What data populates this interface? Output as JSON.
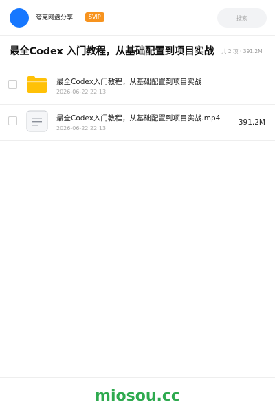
{
  "header": {
    "brand": "夸克网盘分享",
    "badge": "SVIP",
    "search_placeholder": "搜索"
  },
  "folder": {
    "title": "最全Codex 入门教程，从基础配置到项目实战",
    "meta": "共 2 项 · 391.2M"
  },
  "files": [
    {
      "icon": "folder-icon",
      "name": "最全Codex入门教程，从基础配置到项目实战",
      "date": "2026-06-22 22:13",
      "size": ""
    },
    {
      "icon": "document-icon",
      "name": "最全Codex入门教程，从基础配置到项目实战.mp4",
      "date": "2026-06-22 22:13",
      "size": "391.2M"
    }
  ],
  "footer": {
    "watermark": "miosou.cc"
  },
  "colors": {
    "accent": "#1677ff",
    "badge": "#f7931e",
    "folder": "#ffc107",
    "watermark": "#2eaa4f"
  }
}
